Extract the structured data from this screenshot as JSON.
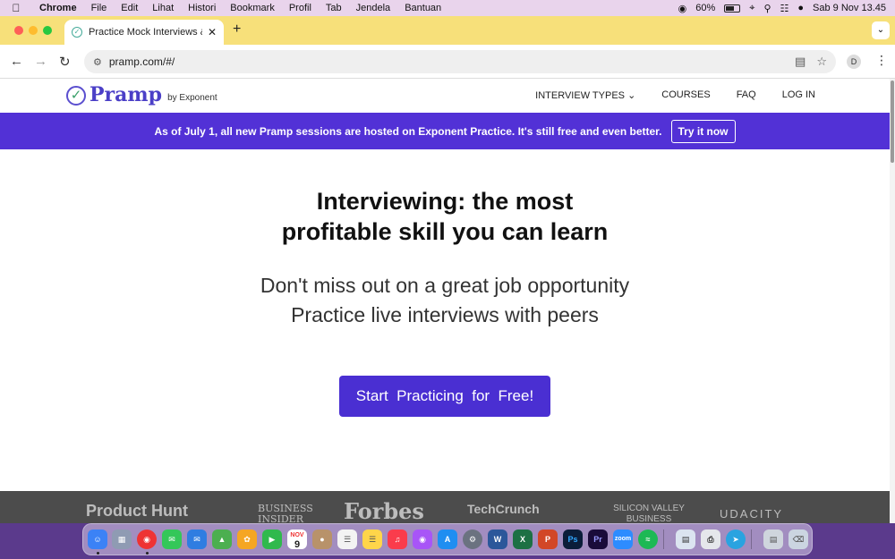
{
  "menubar": {
    "app": "Chrome",
    "items": [
      "File",
      "Edit",
      "Lihat",
      "Histori",
      "Bookmark",
      "Profil",
      "Tab",
      "Jendela",
      "Bantuan"
    ],
    "battery": "60%",
    "datetime": "Sab 9 Nov  13.45"
  },
  "browser": {
    "tab_title": "Practice Mock Interviews & C",
    "url": "pramp.com/#/",
    "profile_initial": "D"
  },
  "site": {
    "logo_text": "Pramp",
    "logo_by": "by Exponent",
    "nav": {
      "interview_types": "INTERVIEW TYPES",
      "courses": "COURSES",
      "faq": "FAQ",
      "login": "LOG IN"
    },
    "banner": {
      "text": "As of July 1, all new Pramp sessions are hosted on Exponent Practice. It's still free and even better.",
      "button": "Try it now"
    },
    "hero": {
      "title_line1": "Interviewing: the most",
      "title_line2": "profitable skill you can learn",
      "sub_line1": "Don't miss out on a great job opportunity",
      "sub_line2": "Practice live interviews with peers"
    },
    "cta": "Start  Practicing  for  Free!",
    "press": [
      "Product Hunt",
      "BUSINESS INSIDER",
      "Forbes",
      "TechCrunch",
      "SILICON VALLEY BUSINESS JOURNAL",
      "UDACITY"
    ]
  },
  "dock": {
    "apps": [
      "Finder",
      "Launchpad",
      "Chrome",
      "Messages",
      "Mail",
      "Maps",
      "Photos",
      "FaceTime",
      "Calendar",
      "Contacts",
      "Reminders",
      "Notes",
      "Music",
      "Podcasts",
      "App Store",
      "System Settings",
      "Word",
      "Excel",
      "PowerPoint",
      "Photoshop",
      "Premiere",
      "Zoom",
      "Spotify",
      "Preview",
      "Printer",
      "Telegram",
      "Documents",
      "Trash"
    ],
    "calendar_month": "NOV",
    "calendar_day": "9"
  },
  "colors": {
    "brand": "#5231d6",
    "cta": "#4a2fd2",
    "tabstrip": "#f7e07a",
    "menubar": "#e9d4ec"
  }
}
